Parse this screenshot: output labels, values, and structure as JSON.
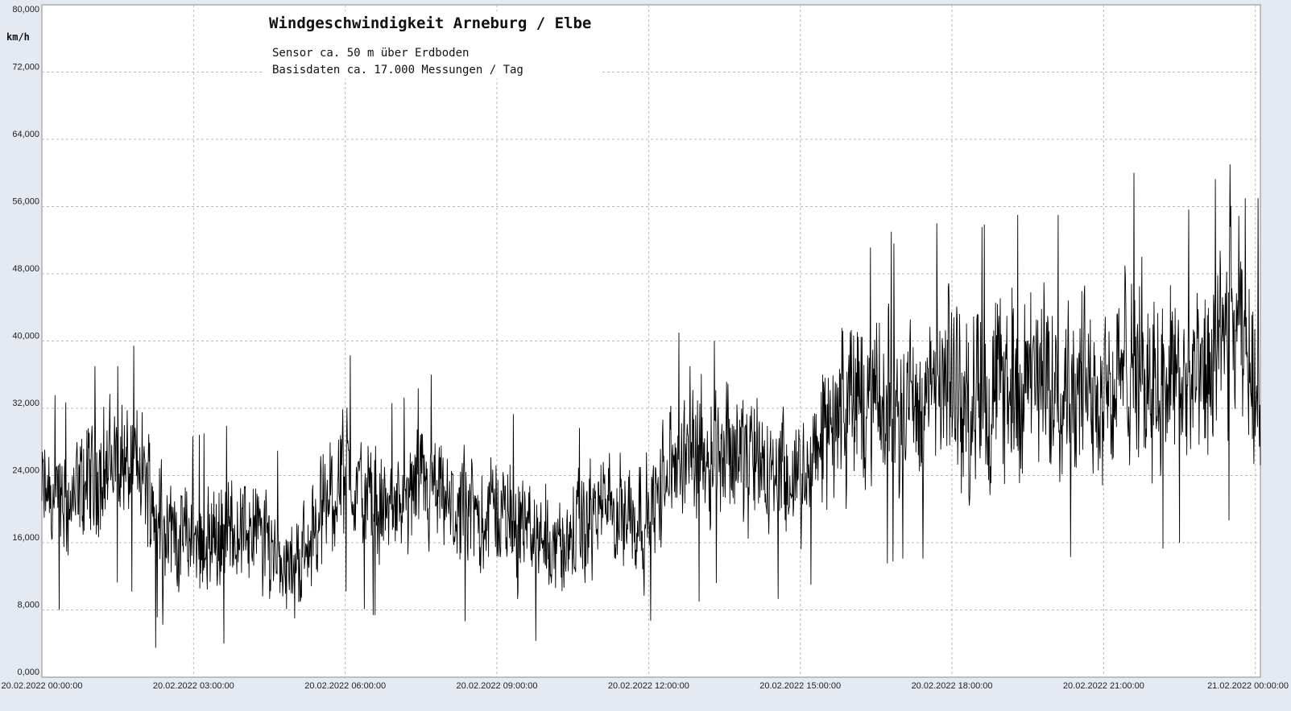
{
  "chart_data": {
    "type": "line",
    "title": "Windgeschwindigkeit  Arneburg / Elbe",
    "subtitle_lines": [
      "Sensor ca. 50 m über Erdboden",
      "Basisdaten ca. 17.000 Messungen / Tag"
    ],
    "ylabel": "km/h",
    "xlabel": "",
    "ylim": [
      0,
      80
    ],
    "yticks": [
      "0,000",
      "8,000",
      "16,000",
      "24,000",
      "32,000",
      "40,000",
      "48,000",
      "56,000",
      "64,000",
      "72,000",
      "80,000"
    ],
    "xlim_hours": [
      0,
      24.1
    ],
    "xticks": [
      {
        "label": "20.02.2022  00:00:00",
        "hour": 0
      },
      {
        "label": "20.02.2022  03:00:00",
        "hour": 3
      },
      {
        "label": "20.02.2022  06:00:00",
        "hour": 6
      },
      {
        "label": "20.02.2022  09:00:00",
        "hour": 9
      },
      {
        "label": "20.02.2022  12:00:00",
        "hour": 12
      },
      {
        "label": "20.02.2022  15:00:00",
        "hour": 15
      },
      {
        "label": "20.02.2022  18:00:00",
        "hour": 18
      },
      {
        "label": "20.02.2022  21:00:00",
        "hour": 21
      },
      {
        "label": "21.02.2022  00:00:00",
        "hour": 24
      }
    ],
    "grid": true,
    "legend": "none",
    "series": [
      {
        "color": "#000000",
        "hours": [
          0,
          0.5,
          1.0,
          1.5,
          2.0,
          2.5,
          3.0,
          3.5,
          4.0,
          4.5,
          5.0,
          5.5,
          6.0,
          6.5,
          7.0,
          7.5,
          8.0,
          8.5,
          9.0,
          9.5,
          10.0,
          10.5,
          11.0,
          11.5,
          12.0,
          12.5,
          13.0,
          13.5,
          14.0,
          14.5,
          15.0,
          15.5,
          16.0,
          16.5,
          17.0,
          17.5,
          18.0,
          18.5,
          19.0,
          19.5,
          20.0,
          20.5,
          21.0,
          21.5,
          22.0,
          22.5,
          23.0,
          23.5,
          24.0
        ],
        "values": [
          22,
          20,
          24,
          26,
          24,
          18,
          16,
          17,
          18,
          16,
          13,
          19,
          25,
          20,
          20,
          22,
          20,
          19,
          20,
          18,
          16,
          16,
          20,
          20,
          19,
          25,
          28,
          28,
          26,
          24,
          22,
          30,
          33,
          32,
          33,
          33,
          35,
          32,
          35,
          34,
          36,
          35,
          35,
          36,
          37,
          35,
          34,
          42,
          36
        ],
        "spread": [
          6,
          6,
          7,
          7,
          7,
          6,
          6,
          6,
          6,
          6,
          5,
          6,
          7,
          6,
          6,
          6,
          6,
          6,
          6,
          6,
          6,
          6,
          6,
          6,
          6,
          7,
          8,
          8,
          8,
          7,
          6,
          8,
          9,
          9,
          9,
          9,
          10,
          10,
          10,
          10,
          10,
          10,
          10,
          10,
          10,
          10,
          10,
          11,
          10
        ],
        "peaks": [
          {
            "hour": 3.6,
            "value": 4
          },
          {
            "hour": 2.25,
            "value": 3.5
          },
          {
            "hour": 5.0,
            "value": 7
          },
          {
            "hour": 1.05,
            "value": 37
          },
          {
            "hour": 1.5,
            "value": 37
          },
          {
            "hour": 7.7,
            "value": 36
          },
          {
            "hour": 12.6,
            "value": 41
          },
          {
            "hour": 13.3,
            "value": 40
          },
          {
            "hour": 13.0,
            "value": 9
          },
          {
            "hour": 16.8,
            "value": 53
          },
          {
            "hour": 17.7,
            "value": 54
          },
          {
            "hour": 19.3,
            "value": 55
          },
          {
            "hour": 20.1,
            "value": 55
          },
          {
            "hour": 21.6,
            "value": 60
          },
          {
            "hour": 22.5,
            "value": 16
          },
          {
            "hour": 23.5,
            "value": 61
          },
          {
            "hour": 23.8,
            "value": 57
          }
        ]
      }
    ]
  }
}
